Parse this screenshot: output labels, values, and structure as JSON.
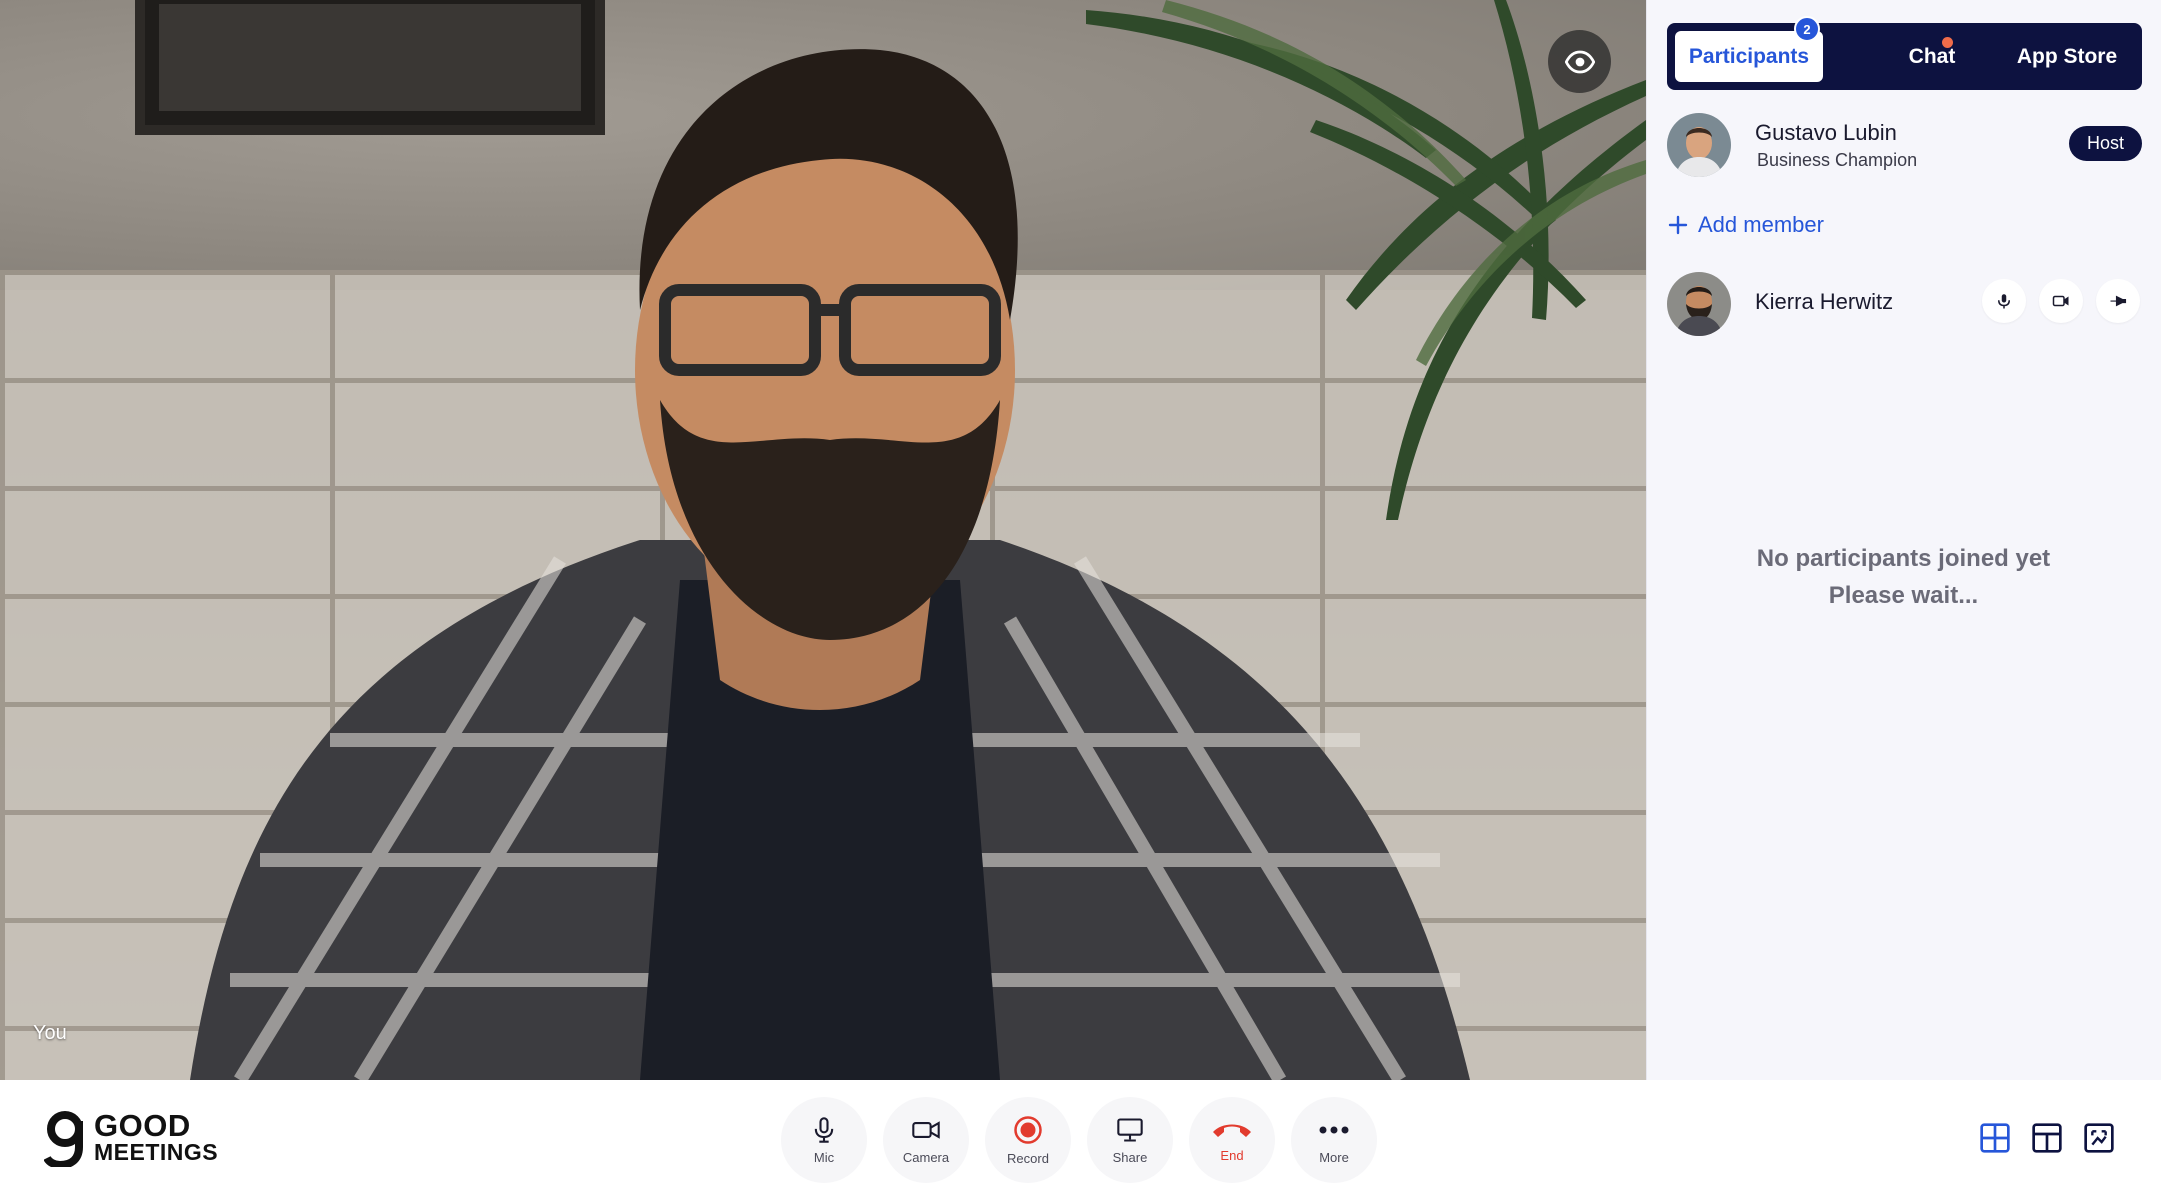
{
  "stage": {
    "self_label": "You",
    "view_toggle_icon": "eye-icon"
  },
  "panel": {
    "tabs": [
      {
        "label": "Participants",
        "active": true
      },
      {
        "label": "Chat",
        "active": false
      },
      {
        "label": "App Store",
        "active": false
      }
    ],
    "participants_count": "2",
    "host": {
      "name": "Gustavo Lubin",
      "role": "Business Champion",
      "badge": "Host"
    },
    "add_member_label": "Add member",
    "members": [
      {
        "name": "Kierra Herwitz",
        "icons": [
          "mic-icon",
          "camera-icon",
          "pin-icon"
        ]
      }
    ],
    "empty_line1": "No participants joined yet",
    "empty_line2": "Please wait..."
  },
  "brand": {
    "line1": "GOOD",
    "line2": "MEETINGS"
  },
  "controls": {
    "mic": "Mic",
    "camera": "Camera",
    "record": "Record",
    "share": "Share",
    "end": "End",
    "more": "More"
  },
  "colors": {
    "accent": "#2656d9",
    "navy": "#0d1240",
    "end_red": "#e23b2e",
    "notification": "#f06c4a"
  }
}
